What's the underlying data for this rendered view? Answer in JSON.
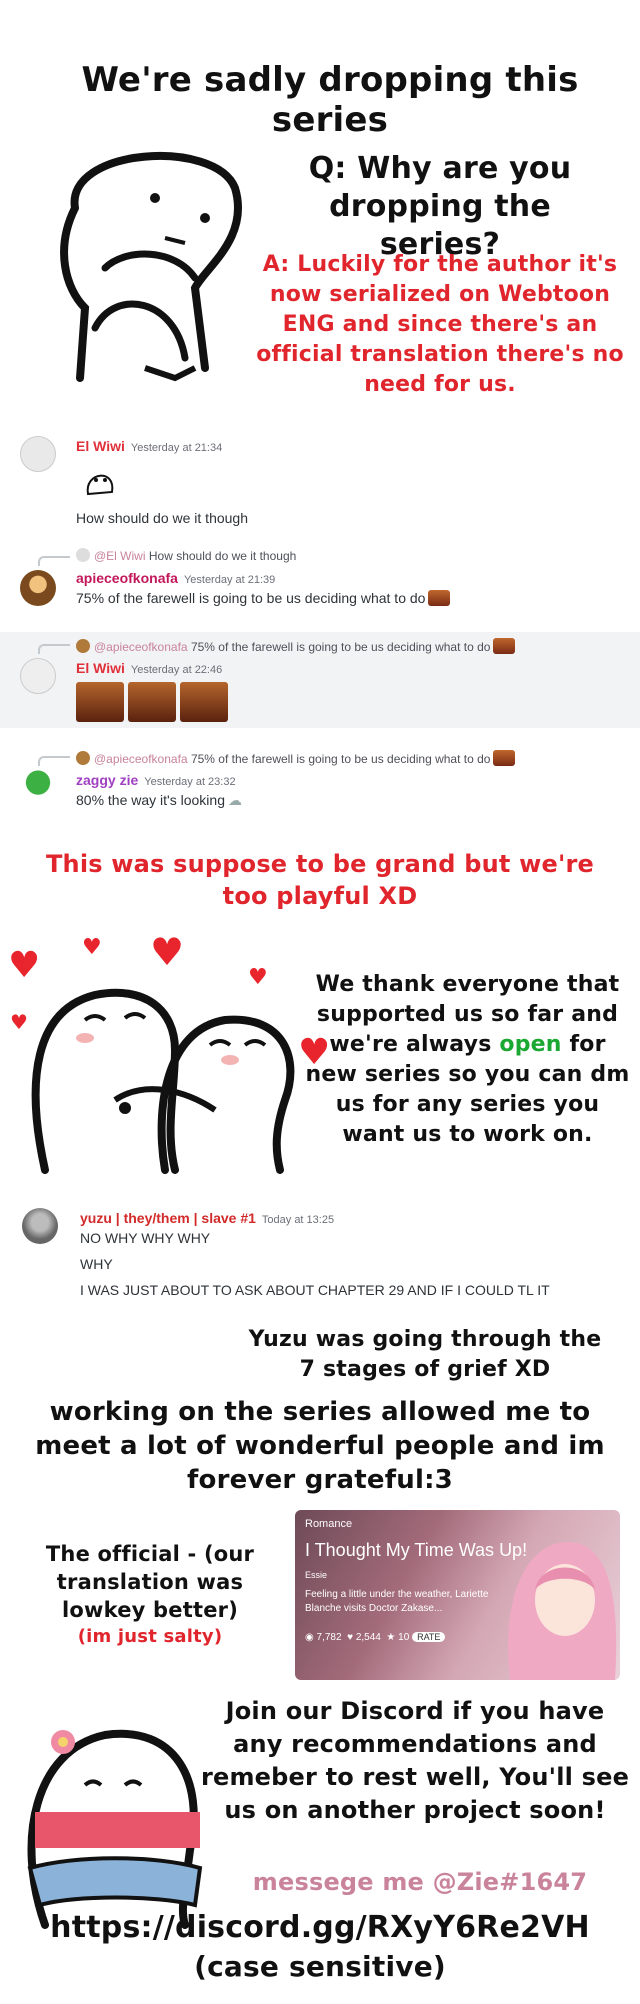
{
  "header": {
    "title": "We're sadly dropping this series",
    "question": "Q: Why are you dropping the series?",
    "answer": "A: Luckily for the author it's now serialized on Webtoon ENG and since there's an official translation there's no need for us."
  },
  "chat1": {
    "m1": {
      "user": "El Wiwi",
      "time": "Yesterday at 21:34",
      "text": "How should do we it though"
    },
    "m2": {
      "reply_user": "@El Wiwi",
      "reply_text": "How should do we it though",
      "user": "apieceofkonafa",
      "time": "Yesterday at 21:39",
      "text": "75% of the farewell is going to be us deciding what to do"
    },
    "m3": {
      "reply_user": "@apieceofkonafa",
      "reply_text": "75% of the farewell is going to be us deciding what to do",
      "user": "El Wiwi",
      "time": "Yesterday at 22:46"
    },
    "m4": {
      "reply_user": "@apieceofkonafa",
      "reply_text": "75% of the farewell is going to be us deciding what to do",
      "user": "zaggy zie",
      "time": "Yesterday at 23:32",
      "text": "80% the way it's looking"
    }
  },
  "playful": "This was suppose to be grand but we're too playful XD",
  "thanks": {
    "before": "We thank everyone that supported us so far and we're always",
    "highlight": "open",
    "after": "for new series so you can dm us for any series you want us to work on."
  },
  "chat2": {
    "user": "yuzu | they/them | slave #1",
    "time": "Today at 13:25",
    "lines": [
      "NO WHY WHY WHY",
      "WHY",
      "I WAS JUST ABOUT TO ASK ABOUT CHAPTER 29 AND IF I COULD TL IT"
    ]
  },
  "yuzu_note": "Yuzu was going through the 7 stages of grief XD",
  "grateful": "working on the series allowed me to meet a lot of wonderful people and im forever grateful:3",
  "official": {
    "line": "The official - (our translation was lowkey better)",
    "aside": "(im just salty)"
  },
  "webtoon_card": {
    "genre": "Romance",
    "title": "I Thought My Time Was Up!",
    "author": "Essie",
    "blurb": "Feeling a little under the weather, Lariette Blanche visits Doctor Zakase...",
    "views": "7,782",
    "likes": "2,544",
    "rating": "10",
    "rate_label": "RATE"
  },
  "discord": {
    "invite_text": "Join our Discord if you have any recommendations and remeber to rest well, You'll see us on another project soon!",
    "contact": "messege me @Zie#1647",
    "link": "https://discord.gg/RXyY6Re2VH",
    "note": "(case sensitive)"
  },
  "colors": {
    "red": "#e0252d",
    "green": "#1aa832",
    "pink": "#c9839a",
    "el_wiwi": "#e0303a",
    "apieceofkonafa": "#c2185b",
    "zaggy": "#a040c0",
    "yuzu": "#d22a2a"
  }
}
